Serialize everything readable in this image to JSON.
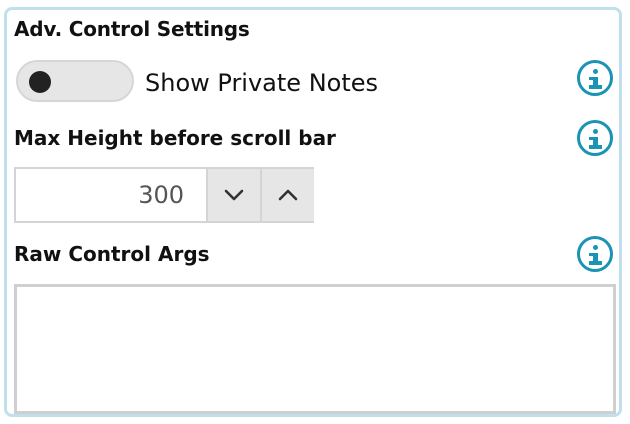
{
  "panel": {
    "title": "Adv. Control Settings"
  },
  "private_notes": {
    "label": "Show Private Notes",
    "enabled": false,
    "info_icon": "info-icon"
  },
  "max_height": {
    "label": "Max Height before scroll bar",
    "value": "300",
    "decrement_icon": "chevron-down-icon",
    "increment_icon": "chevron-up-icon",
    "info_icon": "info-icon"
  },
  "raw_args": {
    "label": "Raw Control Args",
    "value": "",
    "info_icon": "info-icon"
  },
  "colors": {
    "accent": "#1a93b4",
    "panel_border": "#bfe0ec",
    "toggle_bg": "#e6e6e6"
  }
}
